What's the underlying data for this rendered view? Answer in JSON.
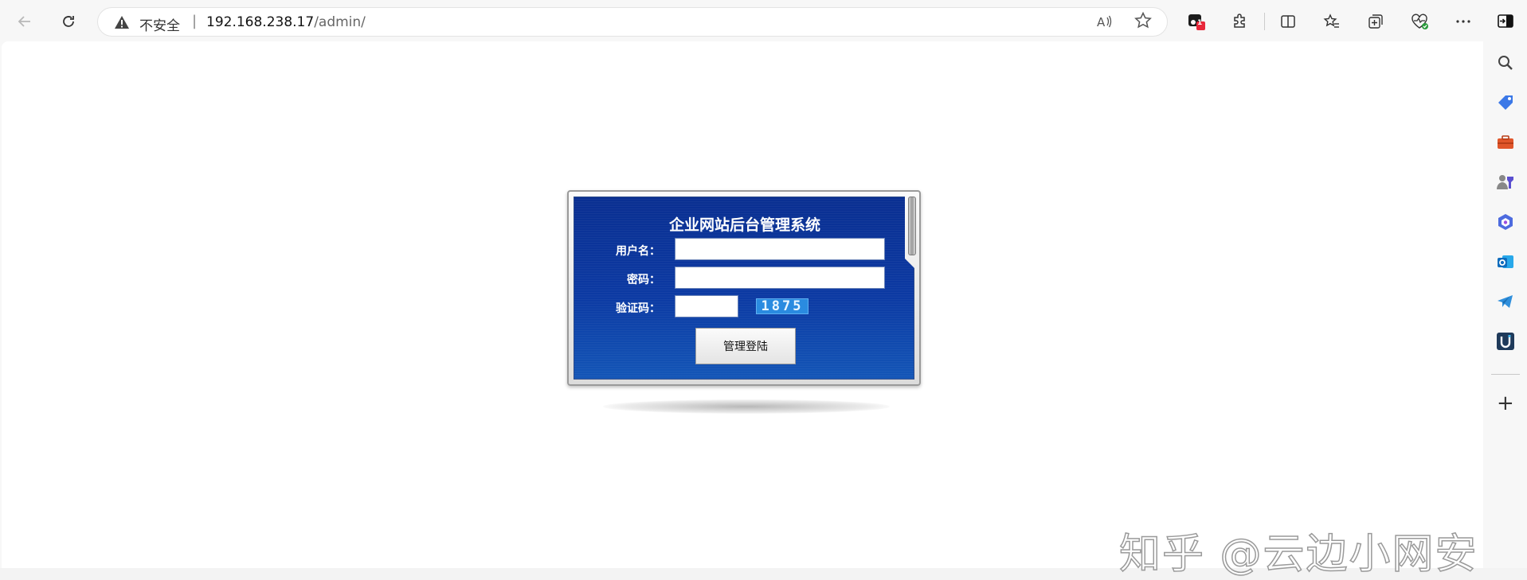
{
  "browser": {
    "address_bar": {
      "security_label": "不安全",
      "separator": "|",
      "host": "192.168.238.17",
      "path": "/admin/"
    },
    "extension_badge": "1",
    "icons": {
      "back": "back-arrow-icon",
      "refresh": "refresh-icon",
      "warning": "warning-triangle-icon",
      "read_aloud": "read-aloud-icon",
      "favorite": "star-icon",
      "extension": "extension-icon",
      "puzzle": "puzzle-icon",
      "split_screen": "split-screen-icon",
      "favorites": "favorites-icon",
      "collections": "collections-icon",
      "health": "browser-essentials-icon",
      "more": "more-icon",
      "sidebar_toggle": "sidebar-toggle-icon"
    },
    "sidebar_icons": [
      "search-icon",
      "shopping-tag-icon",
      "tools-icon",
      "games-icon",
      "copilot-icon",
      "outlook-icon",
      "telegram-icon",
      "u-app-icon"
    ],
    "sidebar_add": "+"
  },
  "login": {
    "title": "企业网站后台管理系统",
    "username_label": "用户名：",
    "password_label": "密码：",
    "captcha_label": "验证码：",
    "username_value": "",
    "password_value": "",
    "captcha_value": "",
    "captcha_text": "1875",
    "submit_label": "管理登陆"
  },
  "watermark": "知乎 @云边小网安"
}
